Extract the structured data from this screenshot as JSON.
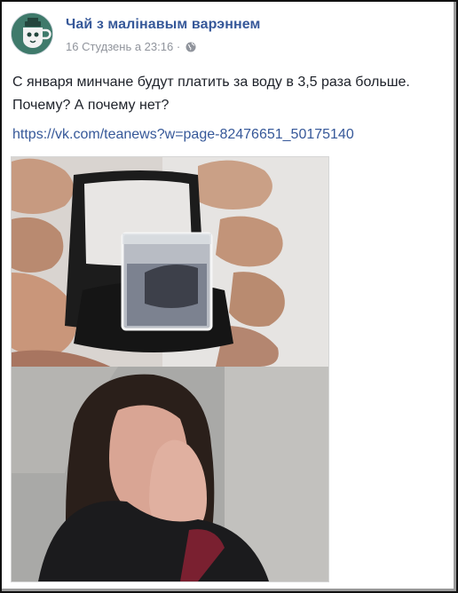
{
  "post": {
    "page_name": "Чай з малінавым варэннем",
    "date": "16 Студзень а 23:16",
    "separator": "·",
    "visibility_icon": "globe-icon",
    "text_lines": [
      "С января минчане будут платить за воду в 3,5 раза больше.",
      "Почему? А почему нет?"
    ],
    "link": "https://vk.com/teanews?w=page-82476651_50175140"
  },
  "avatar": {
    "icon": "teapot-logo",
    "bg_color": "#3f7a6b"
  },
  "colors": {
    "link": "#365899",
    "meta": "#90949c",
    "text": "#1d2129"
  },
  "image": {
    "top_panel": "hands-holding-ring-box-with-glass-of-water",
    "bottom_panel": "crying-woman-covering-mouth"
  }
}
